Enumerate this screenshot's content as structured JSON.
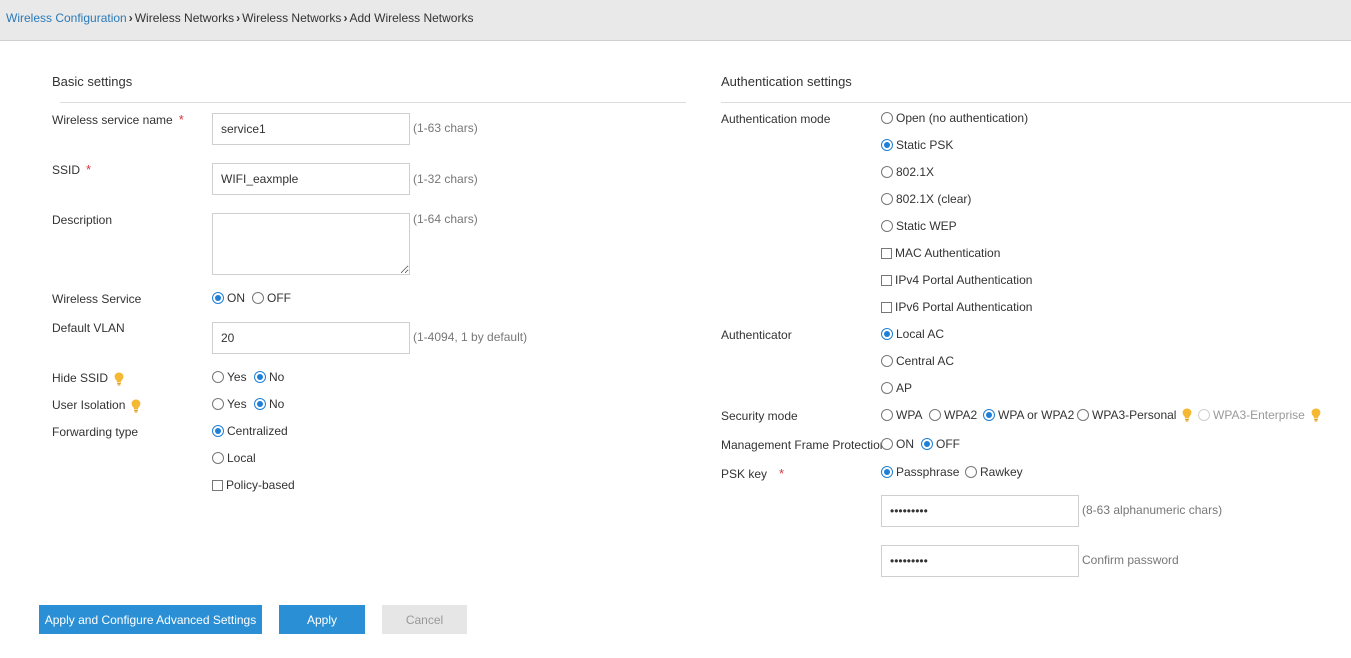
{
  "breadcrumb": {
    "root": "Wireless Configuration",
    "items": [
      "Wireless Networks",
      "Wireless Networks",
      "Add Wireless Networks"
    ]
  },
  "basic": {
    "title": "Basic settings",
    "service_name": {
      "label": "Wireless service name",
      "required": "*",
      "value": "service1",
      "hint": "(1-63 chars)"
    },
    "ssid": {
      "label": "SSID",
      "required": "*",
      "value": "WIFI_eaxmple",
      "hint": "(1-32 chars)"
    },
    "description": {
      "label": "Description",
      "value": "",
      "hint": "(1-64 chars)"
    },
    "wireless_service": {
      "label": "Wireless Service",
      "on": "ON",
      "off": "OFF",
      "selected": "ON"
    },
    "default_vlan": {
      "label": "Default VLAN",
      "value": "20",
      "hint": "(1-4094, 1 by default)"
    },
    "hide_ssid": {
      "label": "Hide SSID",
      "yes": "Yes",
      "no": "No",
      "selected": "No"
    },
    "user_isolation": {
      "label": "User Isolation",
      "yes": "Yes",
      "no": "No",
      "selected": "No"
    },
    "forwarding_type": {
      "label": "Forwarding type",
      "centralized": "Centralized",
      "local": "Local",
      "policy": "Policy-based",
      "selected": "Centralized"
    }
  },
  "auth": {
    "title": "Authentication settings",
    "mode": {
      "label": "Authentication mode",
      "open": "Open (no authentication)",
      "static_psk": "Static PSK",
      "dot1x": "802.1X",
      "dot1x_clear": "802.1X (clear)",
      "static_wep": "Static WEP",
      "mac_auth": "MAC Authentication",
      "ipv4_portal": "IPv4 Portal Authentication",
      "ipv6_portal": "IPv6 Portal Authentication",
      "selected": "Static PSK"
    },
    "authenticator": {
      "label": "Authenticator",
      "local_ac": "Local AC",
      "central_ac": "Central AC",
      "ap": "AP",
      "selected": "Local AC"
    },
    "security_mode": {
      "label": "Security mode",
      "wpa": "WPA",
      "wpa2": "WPA2",
      "wpa_or_wpa2": "WPA or WPA2",
      "wpa3_personal": "WPA3-Personal",
      "wpa3_enterprise": "WPA3-Enterprise",
      "selected": "WPA or WPA2"
    },
    "mfp": {
      "label": "Management Frame Protection",
      "on": "ON",
      "off": "OFF",
      "selected": "OFF"
    },
    "psk_key": {
      "label": "PSK key",
      "required": "*",
      "passphrase": "Passphrase",
      "rawkey": "Rawkey",
      "selected": "Passphrase"
    },
    "password": {
      "value": "password1",
      "hint": "(8-63 alphanumeric chars)"
    },
    "confirm": {
      "value": "password1",
      "hint": "Confirm password"
    }
  },
  "buttons": {
    "apply_configure": "Apply and Configure Advanced Settings",
    "apply": "Apply",
    "cancel": "Cancel"
  },
  "colors": {
    "accent": "#2a8fd4",
    "link": "#2a7ab8",
    "required": "#d9363e",
    "tip": "#f5b833"
  },
  "icons": {
    "tip": "lightbulb-icon",
    "separator": "chevron-right-icon"
  }
}
